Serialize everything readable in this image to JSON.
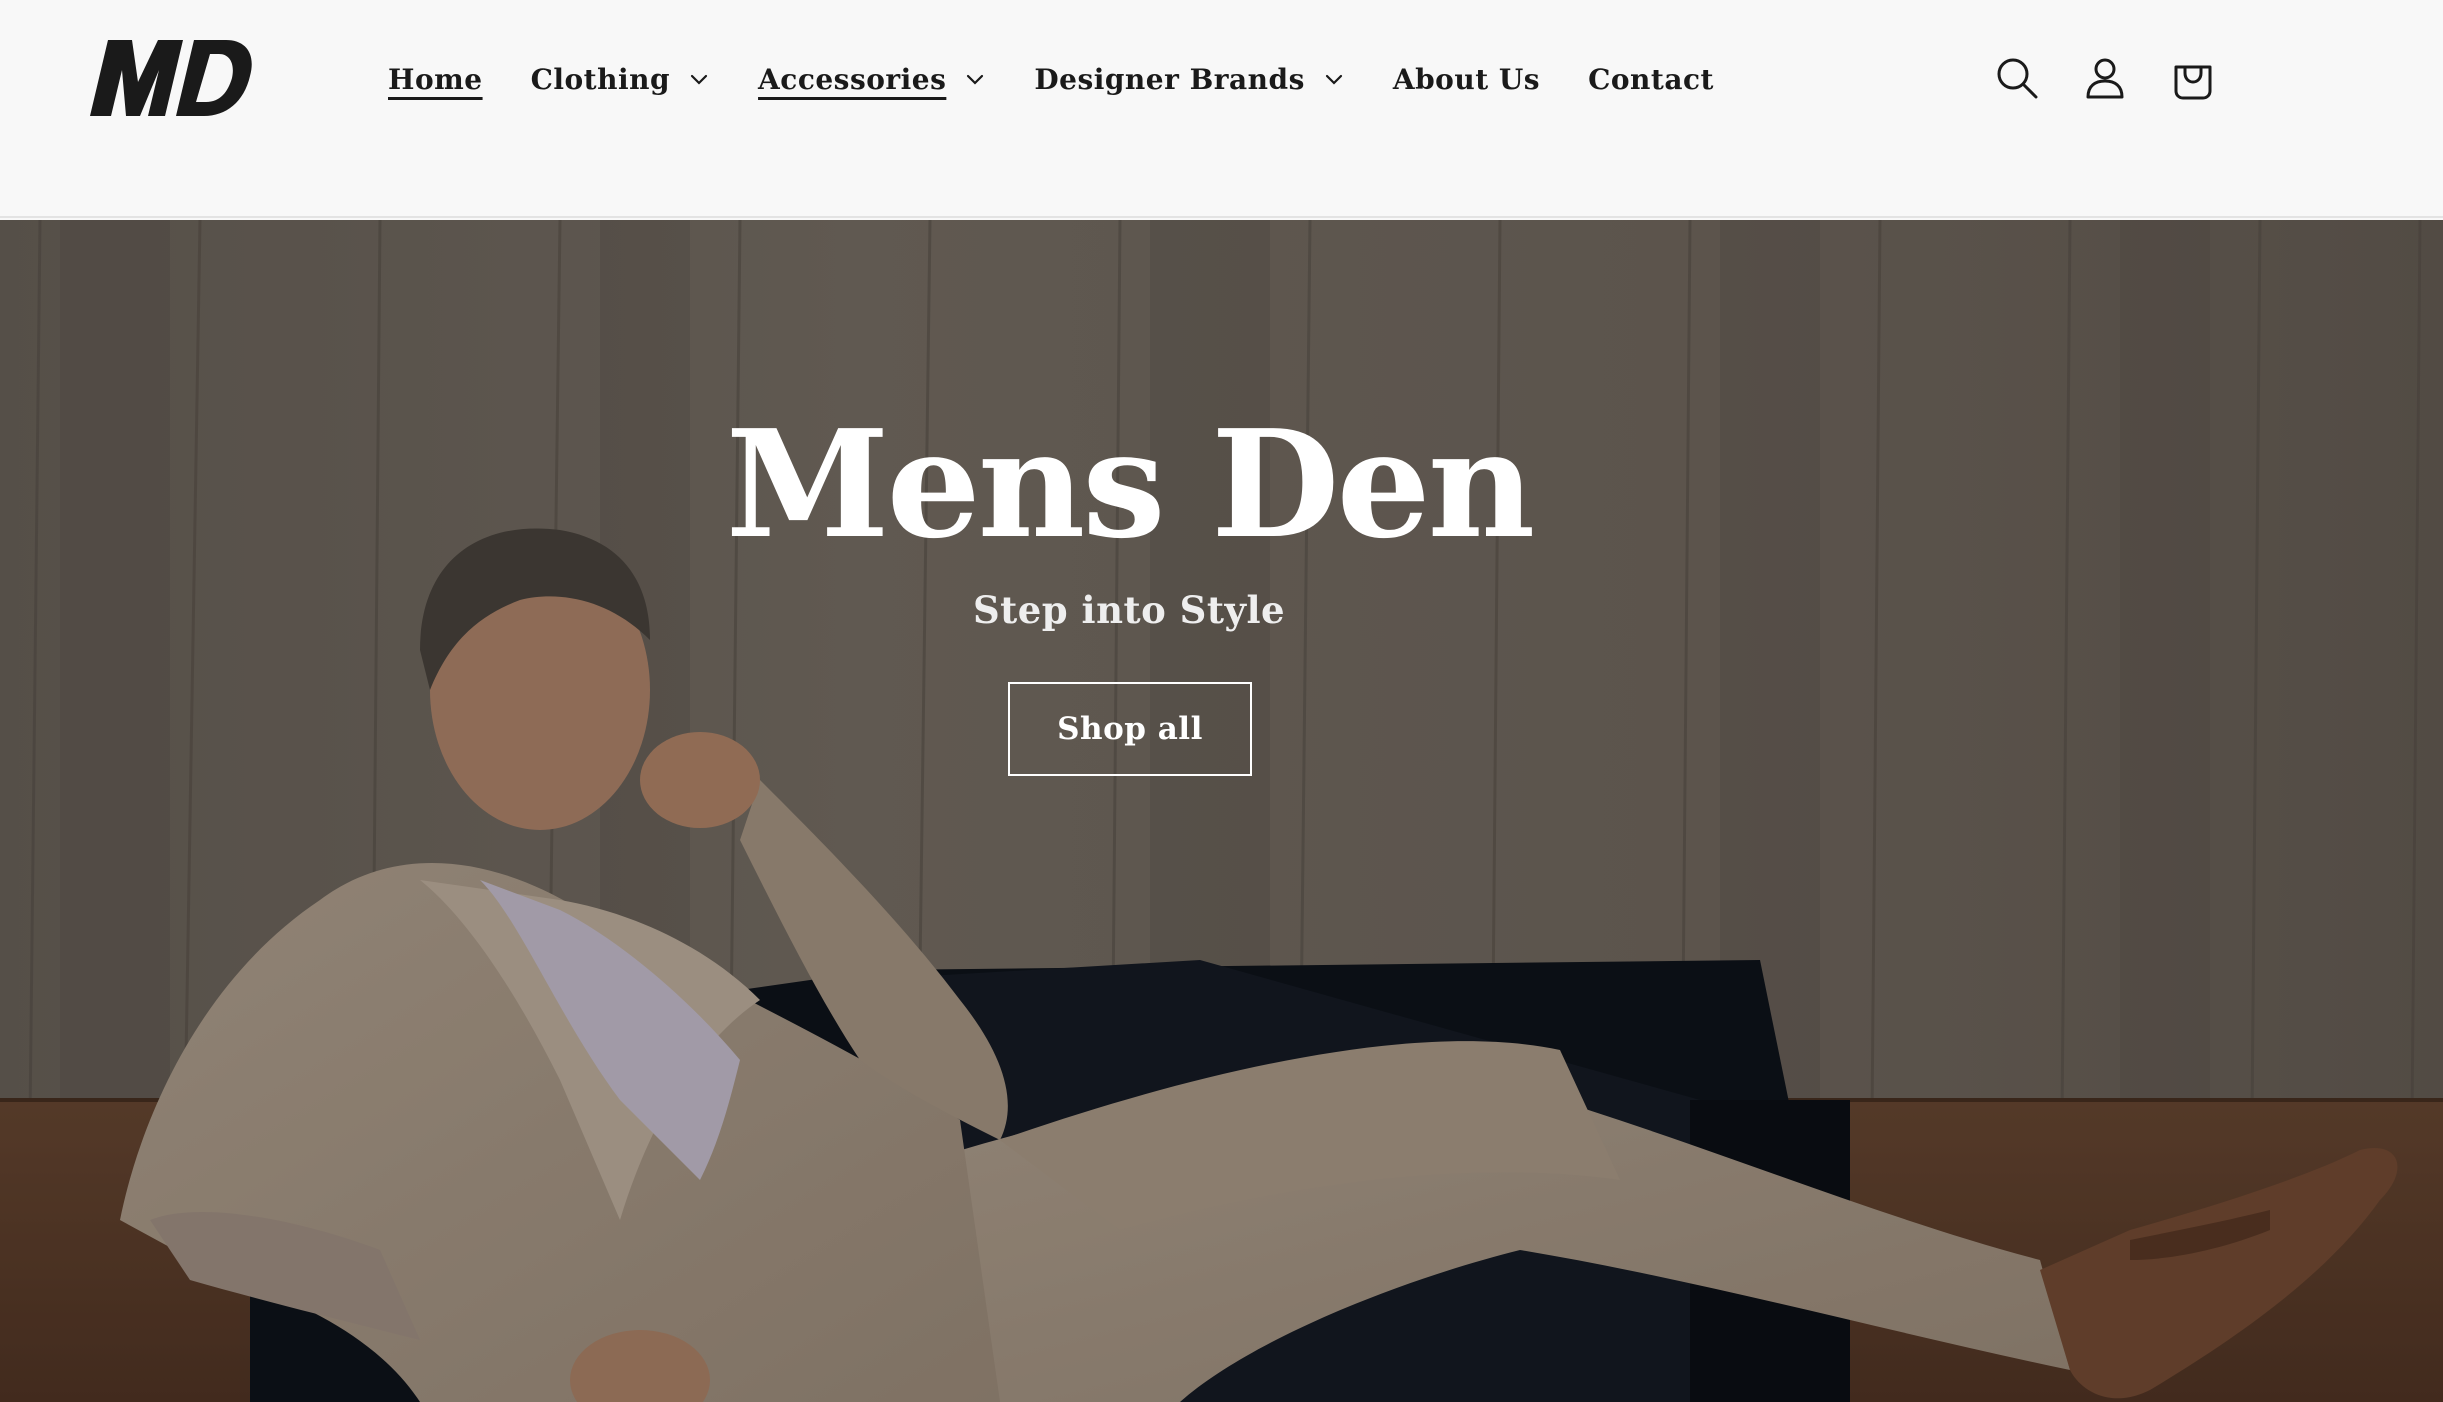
{
  "header": {
    "logo_text": "MD",
    "nav": [
      {
        "label": "Home",
        "has_dropdown": false,
        "active": true
      },
      {
        "label": "Clothing",
        "has_dropdown": true,
        "active": false
      },
      {
        "label": "Accessories",
        "has_dropdown": true,
        "active": true
      },
      {
        "label": "Designer Brands",
        "has_dropdown": true,
        "active": false
      },
      {
        "label": "About Us",
        "has_dropdown": false,
        "active": false
      },
      {
        "label": "Contact",
        "has_dropdown": false,
        "active": false
      }
    ],
    "icons": [
      "search-icon",
      "account-icon",
      "cart-icon"
    ]
  },
  "hero": {
    "title": "Mens Den",
    "subtitle": "Step into Style",
    "button_label": "Shop all"
  },
  "colors": {
    "header_bg": "#f8f8f8",
    "text": "#121212",
    "hero_text": "#ffffff"
  }
}
